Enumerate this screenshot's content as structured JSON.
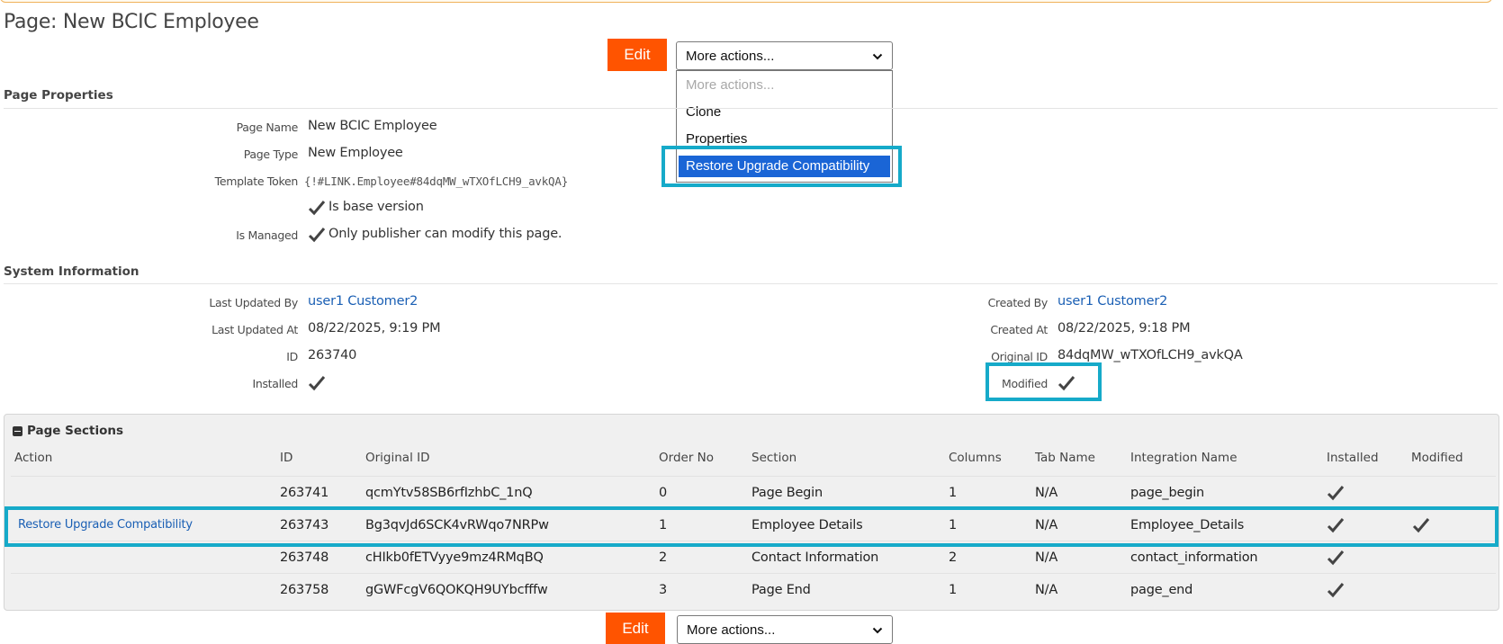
{
  "page": {
    "title": "Page: New BCIC Employee"
  },
  "actions": {
    "edit_label": "Edit",
    "more_actions_value": "More actions...",
    "dropdown_options": [
      "More actions...",
      "Clone",
      "Properties",
      "Restore Upgrade Compatibility"
    ],
    "dropdown_selected": "Restore Upgrade Compatibility"
  },
  "properties": {
    "heading": "Page Properties",
    "page_name_label": "Page Name",
    "page_name": "New BCIC Employee",
    "page_type_label": "Page Type",
    "page_type": "New Employee",
    "template_token_label": "Template Token",
    "template_token": "{!#LINK.Employee#84dqMW_wTXOfLCH9_avkQA}",
    "base_version_text": "Is base version",
    "is_managed_label": "Is Managed",
    "is_managed_text": "Only publisher can modify this page."
  },
  "system": {
    "heading": "System Information",
    "last_updated_by_label": "Last Updated By",
    "last_updated_by": "user1 Customer2",
    "last_updated_at_label": "Last Updated At",
    "last_updated_at": "08/22/2025, 9:19 PM",
    "id_label": "ID",
    "id": "263740",
    "installed_label": "Installed",
    "created_by_label": "Created By",
    "created_by": "user1 Customer2",
    "created_at_label": "Created At",
    "created_at": "08/22/2025, 9:18 PM",
    "original_id_label": "Original ID",
    "original_id": "84dqMW_wTXOfLCH9_avkQA",
    "modified_label": "Modified"
  },
  "sections": {
    "heading": "Page Sections",
    "columns": [
      "Action",
      "ID",
      "Original ID",
      "Order No",
      "Section",
      "Columns",
      "Tab Name",
      "Integration Name",
      "Installed",
      "Modified"
    ],
    "rows": [
      {
        "action": "",
        "id": "263741",
        "original_id": "qcmYtv58SB6rfIzhbC_1nQ",
        "order": "0",
        "section": "Page Begin",
        "columns": "1",
        "tab": "N/A",
        "integration": "page_begin",
        "installed": true,
        "modified": false
      },
      {
        "action": "Restore Upgrade Compatibility",
        "id": "263743",
        "original_id": "Bg3qvJd6SCK4vRWqo7NRPw",
        "order": "1",
        "section": "Employee Details",
        "columns": "1",
        "tab": "N/A",
        "integration": "Employee_Details",
        "installed": true,
        "modified": true
      },
      {
        "action": "",
        "id": "263748",
        "original_id": "cHIkb0fETVyye9mz4RMqBQ",
        "order": "2",
        "section": "Contact Information",
        "columns": "2",
        "tab": "N/A",
        "integration": "contact_information",
        "installed": true,
        "modified": false
      },
      {
        "action": "",
        "id": "263758",
        "original_id": "gGWFcgV6QOKQH9UYbcfffw",
        "order": "3",
        "section": "Page End",
        "columns": "1",
        "tab": "N/A",
        "integration": "page_end",
        "installed": true,
        "modified": false
      }
    ]
  },
  "colors": {
    "edit_button": "#ff5400",
    "highlight": "#16aac9",
    "selected_option": "#1a65d6",
    "link": "#1a5fb4"
  },
  "icons": {
    "check": "checkmark-icon",
    "chevron": "chevron-down-icon",
    "collapse": "minus-square-icon"
  }
}
